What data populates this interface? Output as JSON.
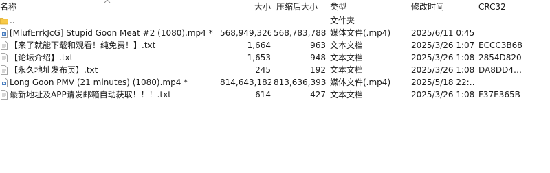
{
  "columns": {
    "name": "名称",
    "size": "大小",
    "packed_size": "压缩后大小",
    "type": "类型",
    "modified": "修改时间",
    "crc": "CRC32"
  },
  "files": [
    {
      "name": "..",
      "size": "",
      "packed": "",
      "type": "文件夹",
      "modified": "",
      "crc": "",
      "icon": "folder-icon"
    },
    {
      "name": "[MlufErrkJcG] Stupid Goon Meat #2 (1080).mp4 *",
      "size": "568,949,326",
      "packed": "568,783,788",
      "type": "媒体文件(.mp4)",
      "modified": "2025/6/11 0:45",
      "crc": "",
      "icon": "video-file-icon"
    },
    {
      "name": "【来了就能下载和观看！纯免费！】.txt",
      "size": "1,664",
      "packed": "963",
      "type": "文本文档",
      "modified": "2025/3/26 1:07",
      "crc": "ECCC3B68",
      "icon": "text-file-icon"
    },
    {
      "name": "【论坛介绍】.txt",
      "size": "1,653",
      "packed": "948",
      "type": "文本文档",
      "modified": "2025/3/26 1:08",
      "crc": "2854D820",
      "icon": "text-file-icon"
    },
    {
      "name": "【永久地址发布页】.txt",
      "size": "245",
      "packed": "192",
      "type": "文本文档",
      "modified": "2025/3/26 1:08",
      "crc": "DA8DD4…",
      "icon": "text-file-icon"
    },
    {
      "name": "Long Goon PMV (21 minutes) (1080).mp4 *",
      "size": "814,643,182",
      "packed": "813,636,393",
      "type": "媒体文件(.mp4)",
      "modified": "2025/5/18 22:…",
      "crc": "",
      "icon": "video-file-icon"
    },
    {
      "name": "最新地址及APP请发邮箱自动获取！！！.txt",
      "size": "614",
      "packed": "427",
      "type": "文本文档",
      "modified": "2025/3/26 1:08",
      "crc": "F37E365B",
      "icon": "text-file-icon"
    }
  ]
}
